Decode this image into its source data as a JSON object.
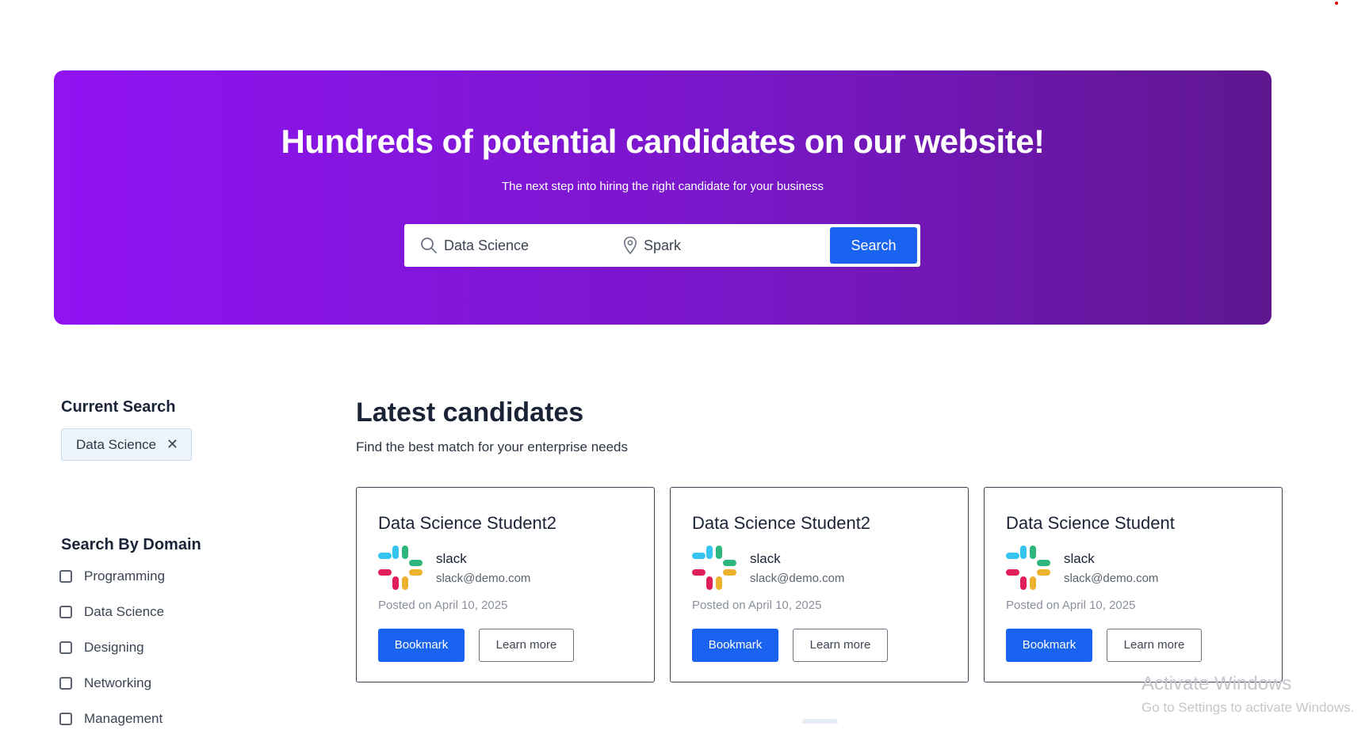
{
  "hero": {
    "title": "Hundreds of potential candidates on our website!",
    "subtitle": "The next step into hiring the right candidate for your business",
    "search": {
      "keyword_value": "Data Science",
      "location_value": "Spark",
      "button_label": "Search"
    },
    "gradient_start": "#9013f3",
    "gradient_end": "#5f1790"
  },
  "sidebar": {
    "current_search_title": "Current Search",
    "current_search_chip": "Data Science",
    "domain_title": "Search By Domain",
    "domains": [
      {
        "label": "Programming",
        "checked": false
      },
      {
        "label": "Data Science",
        "checked": false
      },
      {
        "label": "Designing",
        "checked": false
      },
      {
        "label": "Networking",
        "checked": false
      },
      {
        "label": "Management",
        "checked": false
      }
    ]
  },
  "main": {
    "title": "Latest candidates",
    "subtitle": "Find the best match for your enterprise needs",
    "cards": [
      {
        "title": "Data Science Student2",
        "company": "slack",
        "email": "slack@demo.com",
        "posted": "Posted on April 10, 2025",
        "bookmark_label": "Bookmark",
        "learn_label": "Learn more",
        "logo_icon": "slack-logo-icon"
      },
      {
        "title": "Data Science Student2",
        "company": "slack",
        "email": "slack@demo.com",
        "posted": "Posted on April 10, 2025",
        "bookmark_label": "Bookmark",
        "learn_label": "Learn more",
        "logo_icon": "slack-logo-icon"
      },
      {
        "title": "Data Science Student",
        "company": "slack",
        "email": "slack@demo.com",
        "posted": "Posted on April 10, 2025",
        "bookmark_label": "Bookmark",
        "learn_label": "Learn more",
        "logo_icon": "slack-logo-icon"
      }
    ]
  },
  "watermark": {
    "line1": "Activate Windows",
    "line2": "Go to Settings to activate Windows."
  },
  "colors": {
    "primary_button": "#1a63f0",
    "text_dark": "#1b2336"
  }
}
